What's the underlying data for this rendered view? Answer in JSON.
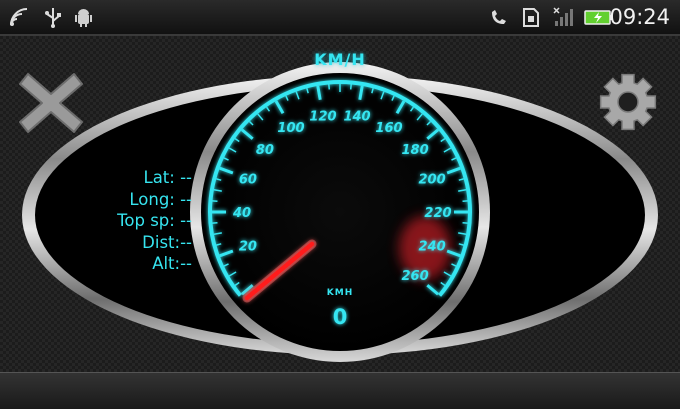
{
  "status_bar": {
    "time": "09:24",
    "icons": [
      "wifi-signal-icon",
      "usb-icon",
      "android-debug-icon",
      "phone-icon",
      "sd-card-icon",
      "signal-bars-icon",
      "battery-charging-icon"
    ],
    "battery_color": "#62d030"
  },
  "speedometer": {
    "unit_title": "KM/H",
    "dial_unit": "KMH",
    "speed": "0",
    "tick_labels": [
      "20",
      "40",
      "60",
      "80",
      "100",
      "120",
      "140",
      "160",
      "180",
      "200",
      "220",
      "240",
      "260"
    ],
    "accent_color": "#35e6f2",
    "needle_color": "#ff1a1a"
  },
  "info": {
    "lat": "Lat: --",
    "long": "Long: --",
    "top_speed": "Top sp: --",
    "dist": "Dist:--",
    "alt": "Alt:--"
  },
  "actions": {
    "close_icon": "close-icon",
    "settings_icon": "gear-icon"
  }
}
